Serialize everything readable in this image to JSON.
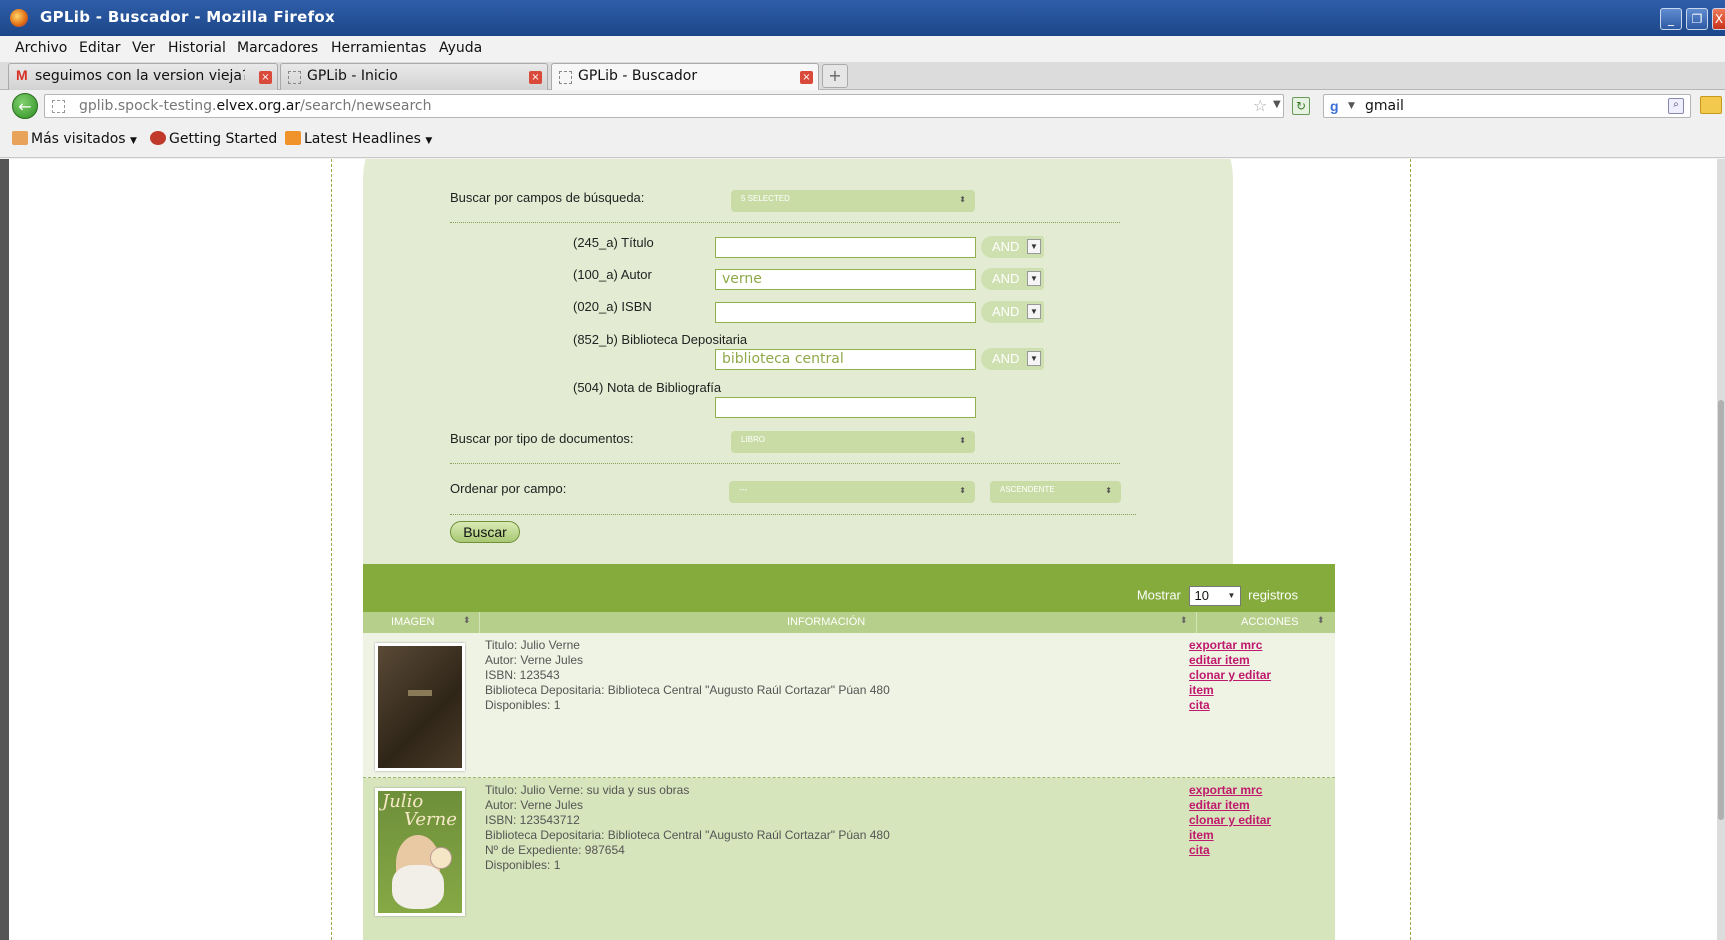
{
  "window": {
    "title": "GPLib - Buscador - Mozilla Firefox",
    "controls": [
      "minimize-icon",
      "restore-icon",
      "close-icon"
    ]
  },
  "menu": [
    "Archivo",
    "Editar",
    "Ver",
    "Historial",
    "Marcadores",
    "Herramientas",
    "Ayuda"
  ],
  "tabs": [
    {
      "label": "seguimos con la version vieja?..."
    },
    {
      "label": "GPLib - Inicio"
    },
    {
      "label": "GPLib - Buscador"
    }
  ],
  "navbar": {
    "url_host_prefix": "gplib.spock-testing.",
    "url_host_domain": "elvex.org.ar",
    "url_path": "/search/newsearch",
    "search_query": "gmail"
  },
  "bookmarks": [
    {
      "label": "Más visitados"
    },
    {
      "label": "Getting Started"
    },
    {
      "label": "Latest Headlines"
    }
  ],
  "search_form": {
    "fields_label": "Buscar por campos de búsqueda:",
    "fields_selected": "5 SELECTED",
    "fields": [
      {
        "label": "(245_a) Título",
        "value": "",
        "op": "AND"
      },
      {
        "label": "(100_a) Autor",
        "value": "verne",
        "op": "AND"
      },
      {
        "label": "(020_a) ISBN",
        "value": "",
        "op": "AND"
      },
      {
        "label": "(852_b) Biblioteca Depositaria",
        "value": "biblioteca central",
        "op": "AND"
      },
      {
        "label": "(504) Nota de Bibliografía",
        "value": ""
      }
    ],
    "doctype_label": "Buscar por tipo de documentos:",
    "doctype_selected": "LIBRO",
    "order_label": "Ordenar por campo:",
    "order_field": "---",
    "order_dir": "ASCENDENTE",
    "submit_label": "Buscar"
  },
  "results": {
    "show_prefix": "Mostrar",
    "show_value": "10",
    "show_suffix": "registros",
    "columns": [
      "IMAGEN",
      "INFORMACIÓN",
      "ACCIONES"
    ],
    "rows": [
      {
        "lines": [
          "Titulo: Julio Verne",
          "Autor: Verne Jules",
          "ISBN: 123543",
          "Biblioteca Depositaria: Biblioteca Central \"Augusto Raúl Cortazar\" Púan 480",
          "Disponibles: 1"
        ],
        "actions": [
          "exportar mrc",
          "editar item",
          "clonar y editar",
          "item",
          "cita"
        ]
      },
      {
        "cover_text": [
          "Julio",
          "Verne"
        ],
        "lines": [
          "Titulo: Julio Verne: su vida y sus obras",
          "Autor: Verne Jules",
          "ISBN: 123543712",
          "Biblioteca Depositaria: Biblioteca Central \"Augusto Raúl Cortazar\" Púan 480",
          "Nº de Expediente: 987654",
          "Disponibles: 1"
        ],
        "actions": [
          "exportar mrc",
          "editar item",
          "clonar y editar",
          "item",
          "cita"
        ]
      }
    ]
  },
  "colors": {
    "titlebar": "#1c4689",
    "panel": "#e3ecd3",
    "results_header": "#84ab3c",
    "action_link": "#c0186c"
  }
}
